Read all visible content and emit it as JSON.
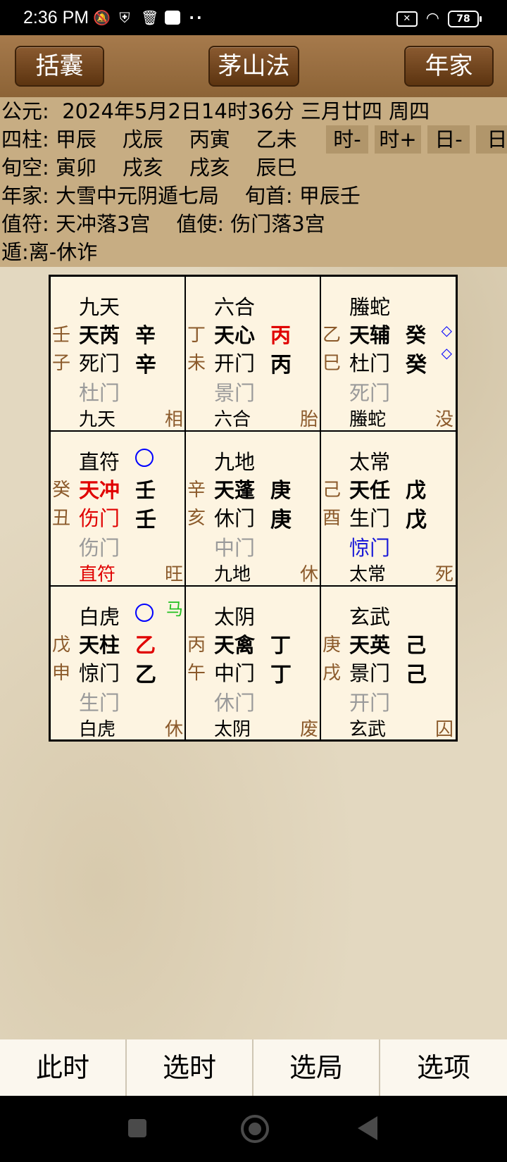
{
  "status_bar": {
    "time": "2:36 PM",
    "battery": "78",
    "icons": [
      "mute-icon",
      "shield-icon",
      "trash-icon",
      "app-icon",
      "more-dots-icon",
      "sim-icon",
      "wifi-icon",
      "battery-icon"
    ]
  },
  "top_buttons": {
    "left": "括囊",
    "center": "茅山法",
    "right": "年家"
  },
  "info": {
    "line1": "公元:  2024年5月2日14时36分 三月廿四 周四",
    "line2": "四柱: 甲辰    戊辰    丙寅    乙未",
    "line3": "旬空: 寅卯    戌亥    戌亥    辰巳",
    "line4": "年家: 大雪中元阴遁七局    旬首: 甲辰壬",
    "line5": "值符: 天冲落3宫    值使: 伤门落3宫",
    "line6": "遁:离-休诈",
    "time_buttons": [
      "时-",
      "时+",
      "日-",
      "日"
    ]
  },
  "palaces": [
    {
      "god": "九天",
      "gz1": "壬",
      "gz2": "子",
      "star": "天芮",
      "tq": "辛",
      "door": "死门",
      "dq": "辛",
      "door2": "杜门",
      "god2": "九天",
      "state": "相"
    },
    {
      "god": "六合",
      "gz1": "丁",
      "gz2": "未",
      "star": "天心",
      "tq": "丙",
      "door": "开门",
      "dq": "丙",
      "door2": "景门",
      "god2": "六合",
      "state": "胎"
    },
    {
      "god": "螣蛇",
      "gz1": "乙",
      "gz2": "巳",
      "star": "天辅",
      "tq": "癸",
      "door": "杜门",
      "dq": "癸",
      "door2": "死门",
      "god2": "螣蛇",
      "state": "没",
      "dia1": "◇",
      "dia2": "◇"
    },
    {
      "god": "直符",
      "gz1": "癸",
      "gz2": "丑",
      "star": "天冲",
      "tq": "壬",
      "door": "伤门",
      "dq": "壬",
      "door2": "伤门",
      "god2": "直符",
      "state": "旺"
    },
    {
      "god": "九地",
      "gz1": "辛",
      "gz2": "亥",
      "star": "天蓬",
      "tq": "庚",
      "door": "休门",
      "dq": "庚",
      "door2": "中门",
      "god2": "九地",
      "state": "休"
    },
    {
      "god": "太常",
      "gz1": "己",
      "gz2": "酉",
      "star": "天任",
      "tq": "戊",
      "door": "生门",
      "dq": "戊",
      "door2": "惊门",
      "god2": "太常",
      "state": "死"
    },
    {
      "god": "白虎",
      "gz1": "戊",
      "gz2": "申",
      "star": "天柱",
      "tq": "乙",
      "door": "惊门",
      "dq": "乙",
      "door2": "生门",
      "god2": "白虎",
      "state": "休",
      "ma": "马"
    },
    {
      "god": "太阴",
      "gz1": "丙",
      "gz2": "午",
      "star": "天禽",
      "tq": "丁",
      "door": "中门",
      "dq": "丁",
      "door2": "休门",
      "god2": "太阴",
      "state": "废"
    },
    {
      "god": "玄武",
      "gz1": "庚",
      "gz2": "戌",
      "star": "天英",
      "tq": "己",
      "door": "景门",
      "dq": "己",
      "door2": "开门",
      "god2": "玄武",
      "state": "囚"
    }
  ],
  "bottom_tabs": [
    "此时",
    "选时",
    "选局",
    "选项"
  ]
}
